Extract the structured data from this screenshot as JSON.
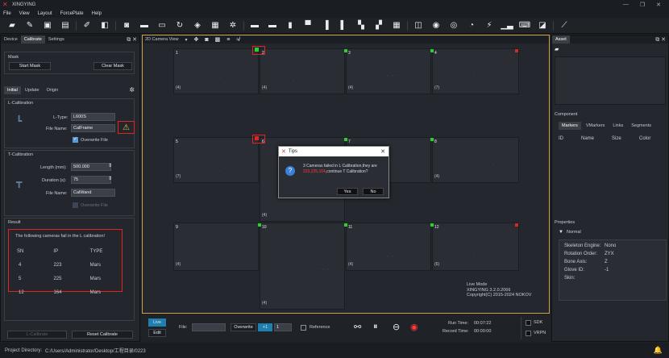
{
  "window": {
    "title": "XINGYING",
    "min": "—",
    "restore": "❐",
    "close": "✕"
  },
  "menu": [
    "File",
    "View",
    "Layout",
    "ForcePlate",
    "Help"
  ],
  "toolbar_icons": [
    "folder-icon",
    "pen-icon",
    "save-icon",
    "save-as-icon",
    "edit-icon",
    "export-icon",
    "camera-icon",
    "car-icon",
    "tablet-icon",
    "refresh-icon",
    "layers-icon",
    "grid-icon",
    "settings-icon",
    "layout-1-icon",
    "layout-2-icon",
    "layout-3-icon",
    "layout-4-icon",
    "layout-5-icon",
    "layout-6-icon",
    "layout-7-icon",
    "layout-8-icon",
    "layout-9-icon",
    "box-icon",
    "record-icon",
    "disc-icon",
    "gauge-icon",
    "plug-icon",
    "bars-icon",
    "keyboard-icon",
    "chart-icon",
    "measure-icon"
  ],
  "left": {
    "tabs": [
      "Device",
      "Calibrate",
      "Settings"
    ],
    "mask": {
      "title": "Mask",
      "start": "Start Mask",
      "clear": "Clear Mask"
    },
    "subtabs": [
      "Initial",
      "Update",
      "Origin"
    ],
    "lcal": {
      "title": "L-Calibration",
      "type_label": "L-Type:",
      "type_value": "L600S",
      "file_label": "File Name:",
      "file_value": "CalFrame",
      "overwrite": "Overwrite File"
    },
    "tcal": {
      "title": "T-Calibration",
      "length_label": "Length (mm):",
      "length_value": "500.000",
      "duration_label": "Duration (s):",
      "duration_value": "75",
      "file_label": "File Name:",
      "file_value": "CalWand",
      "overwrite": "Overwrite File"
    },
    "result": {
      "title": "Result",
      "message": "The following cameras fail in the L calibration!",
      "headers": [
        "SN",
        "IP",
        "TYPE"
      ],
      "rows": [
        [
          "4",
          "223",
          "Mars"
        ],
        [
          "5",
          "225",
          "Mars"
        ],
        [
          "12",
          "164",
          "Mars"
        ]
      ]
    },
    "lcal_btn": "L-Calibrate",
    "reset_btn": "Reset Calibrate"
  },
  "center": {
    "view_label": "2D Camera View",
    "cells": [
      {
        "num": "1",
        "count": "(4)"
      },
      {
        "num": "2",
        "count": "(4)"
      },
      {
        "num": "3",
        "count": "(4)"
      },
      {
        "num": "4",
        "count": "(7)"
      },
      {
        "num": "5",
        "count": "(7)"
      },
      {
        "num": "6",
        "count": "(4)"
      },
      {
        "num": "7",
        "count": ""
      },
      {
        "num": "8",
        "count": "(4)"
      },
      {
        "num": "9",
        "count": "(4)"
      },
      {
        "num": "10",
        "count": "(4)"
      },
      {
        "num": "11",
        "count": "(4)"
      },
      {
        "num": "12",
        "count": "(6)"
      }
    ],
    "live_mode": "Live Mode",
    "version": "XINGYING 3.2.0.2066",
    "copyright": "Copyright(C) 2015-2024 NOKOV"
  },
  "dialog": {
    "title": "Tips",
    "message_pre": "3 Cameras failed in L Calibration,they are ",
    "message_ips": "223,225,164",
    "message_post": ",continue T Calibration?",
    "yes": "Yes",
    "no": "No"
  },
  "right": {
    "asset_title": "Asset",
    "component_title": "Component",
    "tabs": [
      "Markers",
      "VMarkers",
      "Links",
      "Segments"
    ],
    "cols": [
      "ID",
      "Name",
      "Size",
      "Color"
    ],
    "properties_title": "Properties",
    "normal": "Normal",
    "props": [
      [
        "Skeleton Engine:",
        "Nono"
      ],
      [
        "Rotation Order:",
        "ZYX"
      ],
      [
        "Bone Axis:",
        "Z"
      ],
      [
        "Glove ID:",
        "-1"
      ],
      [
        "Skin:",
        ""
      ]
    ]
  },
  "bottom": {
    "live": "Live",
    "edit": "Edit",
    "file_label": "File:",
    "overwrite": "Overwrite",
    "plus": "+1",
    "stepper": "1",
    "reference": "Reference",
    "run_time_label": "Run Time:",
    "run_time": "00:07:22",
    "record_time_label": "Record Time:",
    "record_time": "00:00:00",
    "sdk": "SDK",
    "vrpn": "VRPN"
  },
  "status": {
    "label": "Project Directory:",
    "path": "C:/Users/Administrator/Desktop/工程目录/0223"
  }
}
